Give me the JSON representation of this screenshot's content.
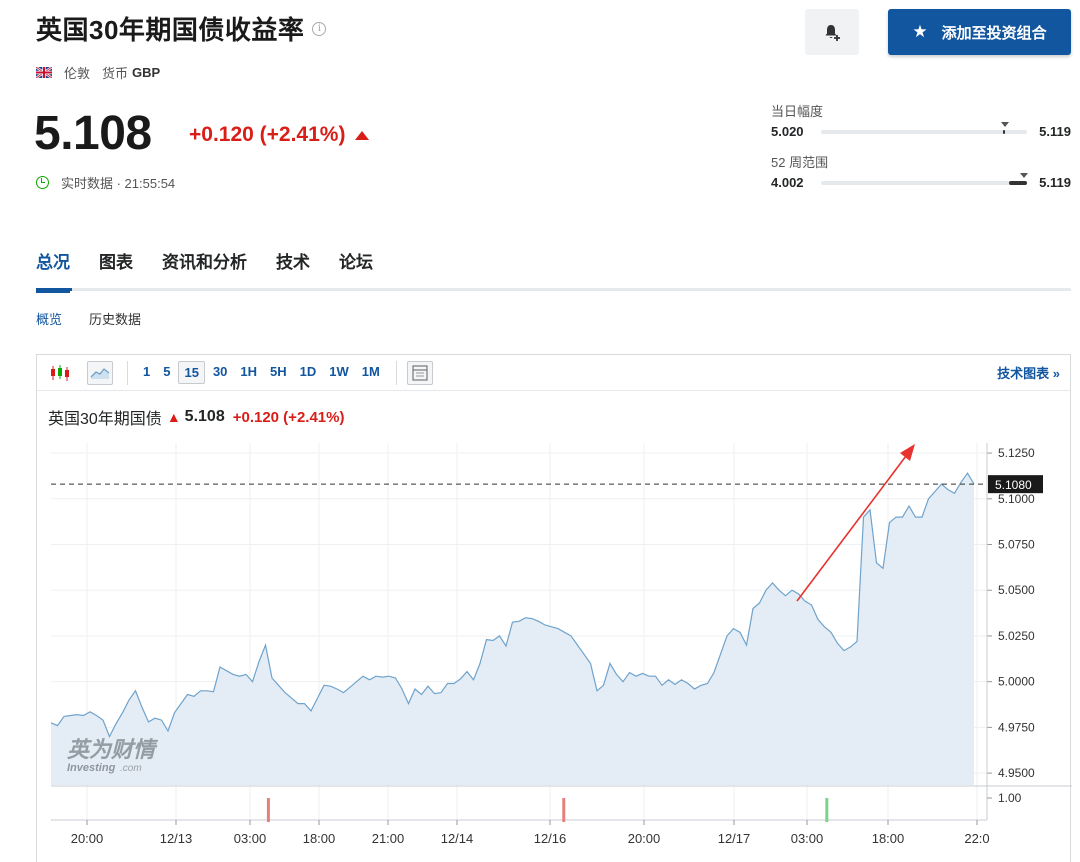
{
  "header": {
    "title": "英国30年期国债收益率",
    "info_icon": "i",
    "city": "伦敦",
    "currency_label": "货币",
    "currency": "GBP",
    "add_button": "添加至投资组合"
  },
  "quote": {
    "price": "5.108",
    "change": "+0.120 (+2.41%)",
    "realtime": "实时数据 · 21:55:54"
  },
  "ranges": {
    "day": {
      "label": "当日幅度",
      "low": "5.020",
      "high": "5.119"
    },
    "week52": {
      "label": "52 周范围",
      "low": "4.002",
      "high": "5.119"
    }
  },
  "tabs": [
    "总况",
    "图表",
    "资讯和分析",
    "技术",
    "论坛"
  ],
  "subtabs": [
    "概览",
    "历史数据"
  ],
  "toolbar": {
    "intervals": [
      "1",
      "5",
      "15",
      "30",
      "1H",
      "5H",
      "1D",
      "1W",
      "1M"
    ],
    "active_interval": "15",
    "tech_chart_link": "技术图表 »"
  },
  "chart_head": {
    "name": "英国30年期国债",
    "value": "5.108",
    "change": "+0.120 (+2.41%)"
  },
  "watermark": {
    "cn": "英为财情",
    "en": "Investing",
    "en_suffix": ".com"
  },
  "colors": {
    "accent": "#1256a0",
    "down": "#d91e18",
    "up": "#0ea600",
    "line": "#6fa3cc",
    "fill": "#e4edf5"
  },
  "chart_data": {
    "type": "area",
    "y_ticks": [
      "5.1250",
      "5.1000",
      "5.0750",
      "5.0500",
      "5.0250",
      "5.0000",
      "4.9750",
      "4.9500"
    ],
    "ylim": [
      4.9435,
      5.1305
    ],
    "current_label": "5.1080",
    "current_value": 5.108,
    "x_ticks": [
      "20:00",
      "12/13",
      "03:00",
      "18:00",
      "21:00",
      "12/14",
      "12/16",
      "20:00",
      "12/17",
      "03:00",
      "18:00",
      "22:0"
    ],
    "volume_tick": "1.00",
    "values": [
      4.9775,
      4.976,
      4.981,
      4.9815,
      4.982,
      4.9815,
      4.9835,
      4.9815,
      4.979,
      4.97,
      4.977,
      4.983,
      4.99,
      4.995,
      4.986,
      4.978,
      4.98,
      4.979,
      4.973,
      4.983,
      4.988,
      4.993,
      4.992,
      4.995,
      4.995,
      4.9945,
      5.008,
      5.006,
      5.004,
      5.003,
      5.004,
      5.0,
      5.011,
      5.02,
      5.002,
      4.998,
      4.994,
      4.991,
      4.988,
      4.988,
      4.984,
      4.991,
      4.998,
      4.9975,
      4.996,
      4.994,
      4.997,
      5.0,
      5.003,
      5.001,
      5.003,
      5.0025,
      5.003,
      5.002,
      4.996,
      4.988,
      4.996,
      4.993,
      4.9975,
      4.9935,
      4.994,
      4.999,
      4.999,
      5.0015,
      5.0055,
      5.001,
      5.01,
      5.023,
      5.0225,
      5.025,
      5.0195,
      5.0325,
      5.033,
      5.035,
      5.0345,
      5.033,
      5.031,
      5.03,
      5.029,
      5.027,
      5.025,
      5.02,
      5.015,
      5.01,
      4.995,
      4.998,
      5.01,
      5.004,
      5.0,
      5.005,
      5.003,
      5.0045,
      5.003,
      5.003,
      4.998,
      5.001,
      4.9985,
      5.001,
      4.999,
      4.996,
      4.998,
      4.999,
      5.005,
      5.015,
      5.025,
      5.029,
      5.027,
      5.02,
      5.04,
      5.043,
      5.05,
      5.054,
      5.05,
      5.047,
      5.05,
      5.048,
      5.044,
      5.042,
      5.034,
      5.03,
      5.027,
      5.021,
      5.017,
      5.019,
      5.022,
      5.09,
      5.094,
      5.065,
      5.062,
      5.087,
      5.09,
      5.09,
      5.096,
      5.09,
      5.09,
      5.1,
      5.104,
      5.108,
      5.105,
      5.103,
      5.109,
      5.114,
      5.108
    ],
    "volume_markers": [
      {
        "pos": 0.235,
        "color": "#e6807a"
      },
      {
        "pos": 0.555,
        "color": "#e6807a"
      },
      {
        "pos": 0.84,
        "color": "#7cd48a"
      }
    ]
  }
}
